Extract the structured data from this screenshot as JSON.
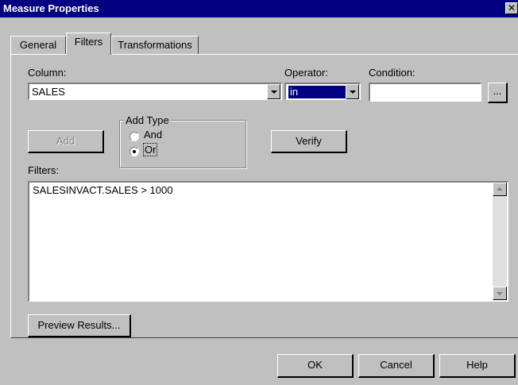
{
  "window": {
    "title": "Measure Properties",
    "close_glyph": "✕"
  },
  "tabs": [
    {
      "label": "General",
      "active": false
    },
    {
      "label": "Filters",
      "active": true
    },
    {
      "label": "Transformations",
      "active": false
    }
  ],
  "column": {
    "label": "Column:",
    "value": "SALES"
  },
  "operator": {
    "label": "Operator:",
    "value": "in"
  },
  "condition": {
    "label": "Condition:",
    "value": "",
    "browse_label": "..."
  },
  "add_button": {
    "label": "Add",
    "enabled": false
  },
  "add_type": {
    "title": "Add Type",
    "options": [
      {
        "label": "And",
        "accel": "n",
        "checked": false
      },
      {
        "label": "Or",
        "accel": "O",
        "checked": true
      }
    ]
  },
  "verify_button": {
    "label": "Verify"
  },
  "filters": {
    "label": "Filters:",
    "text": "SALESINVACT.SALES > 1000"
  },
  "preview_button": {
    "label": "Preview Results..."
  },
  "footer": {
    "ok": "OK",
    "cancel": "Cancel",
    "help": "Help"
  }
}
